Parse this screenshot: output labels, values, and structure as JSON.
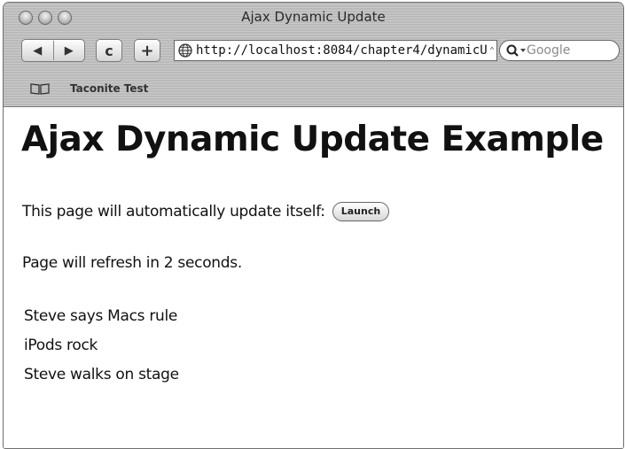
{
  "window": {
    "title": "Ajax Dynamic Update"
  },
  "toolbar": {
    "url": "http://localhost:8084/chapter4/dynamicU",
    "search_placeholder": "Google",
    "back_glyph": "◀",
    "forward_glyph": "▶",
    "reload_glyph": "c",
    "add_bookmark_glyph": "+"
  },
  "bookmarks_bar": {
    "items": [
      "Taconite Test"
    ]
  },
  "page": {
    "heading": "Ajax Dynamic Update Example",
    "intro_text": "This page will automatically update itself:",
    "launch_button": "Launch",
    "refresh_text": "Page will refresh in 2 seconds.",
    "messages": [
      "Steve says Macs rule",
      "iPods rock",
      "Steve walks on stage"
    ]
  },
  "icons": {
    "traffic_lights": [
      "close-icon",
      "minimize-icon",
      "zoom-icon"
    ],
    "url_favicon": "globe-icon",
    "search": "magnifier-icon",
    "bookmarks": "open-book-icon"
  }
}
